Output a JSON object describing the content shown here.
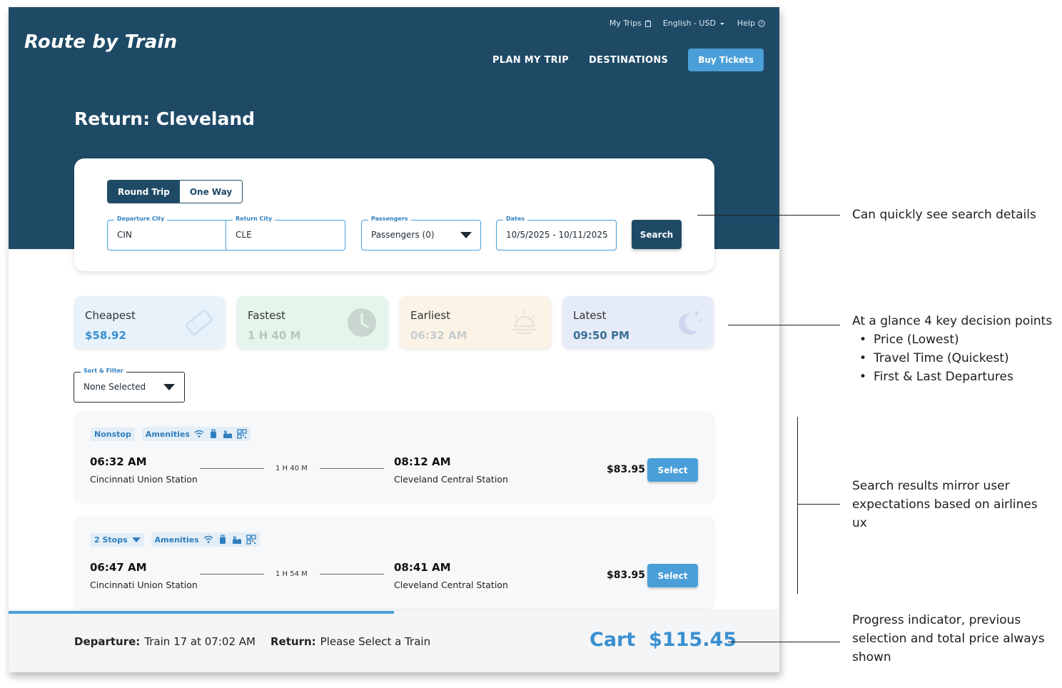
{
  "brand": {
    "logo": "Route by Train"
  },
  "utility": {
    "my_trips": "My Trips",
    "language": "English - USD",
    "help": "Help"
  },
  "nav": {
    "plan": "PLAN MY TRIP",
    "destinations": "DESTINATIONS",
    "buy": "Buy Tickets"
  },
  "page": {
    "title": "Return: Cleveland"
  },
  "search": {
    "round_trip": "Round Trip",
    "one_way": "One Way",
    "departure_label": "Departure City",
    "departure_value": "CIN",
    "return_label": "Return City",
    "return_value": "CLE",
    "passengers_label": "Passengers",
    "passengers_value": "Passengers  (0)",
    "dates_label": "Dates",
    "dates_value": "10/5/2025 - 10/11/2025",
    "button": "Search"
  },
  "stats": [
    {
      "name": "Cheapest",
      "value": "$58.92",
      "color": "#3a8fd0",
      "bg": "#e8f2fa"
    },
    {
      "name": "Fastest",
      "value": "1 H 40 M",
      "color": "#b8c6bd",
      "bg": "#e4f6ec"
    },
    {
      "name": "Earliest",
      "value": "06:32 AM",
      "color": "#c8ccd0",
      "bg": "#fbf4e6"
    },
    {
      "name": "Latest",
      "value": "09:50 PM",
      "color": "#3a6f96",
      "bg": "#e6ebf8"
    }
  ],
  "sort": {
    "label": "Sort & Filter",
    "value": "None Selected"
  },
  "results": [
    {
      "stops": "Nonstop",
      "amenities": "Amenities",
      "dep_time": "06:32 AM",
      "dep_station": "Cincinnati Union Station",
      "duration": "1 H 40 M",
      "arr_time": "08:12 AM",
      "arr_station": "Cleveland Central Station",
      "price": "$83.95",
      "select": "Select"
    },
    {
      "stops": "2 Stops",
      "amenities": "Amenities",
      "dep_time": "06:47 AM",
      "dep_station": "Cincinnati Union Station",
      "duration": "1 H 54 M",
      "arr_time": "08:41 AM",
      "arr_station": "Cleveland Central Station",
      "price": "$83.95",
      "select": "Select"
    }
  ],
  "footer": {
    "progress": 0.5,
    "departure_label": "Departure:",
    "departure_value": "Train 17 at 07:02 AM",
    "return_label": "Return:",
    "return_value": "Please Select a Train",
    "cart": "Cart  $115.45"
  },
  "annotations": {
    "search_details": "Can quickly see search details",
    "decision_title": "At a glance 4 key decision points",
    "decision_items": [
      "Price (Lowest)",
      "Travel Time (Quickest)",
      "First & Last Departures"
    ],
    "results_line1": "Search results mirror user",
    "results_line2": "expectations based on airlines",
    "results_line3": "ux",
    "progress_line1": "Progress indicator, previous",
    "progress_line2": "selection and total price always",
    "progress_line3": "shown"
  },
  "colors": {
    "primary": "#1e4a66",
    "accent": "#4a9fd8"
  },
  "icons": [
    "clipboard-icon",
    "chevron-down-icon",
    "help-circle-icon",
    "ticket-icon",
    "clock-icon",
    "sunrise-icon",
    "moon-stars-icon",
    "wifi-icon",
    "luggage-icon",
    "food-icon",
    "qr-code-icon"
  ]
}
